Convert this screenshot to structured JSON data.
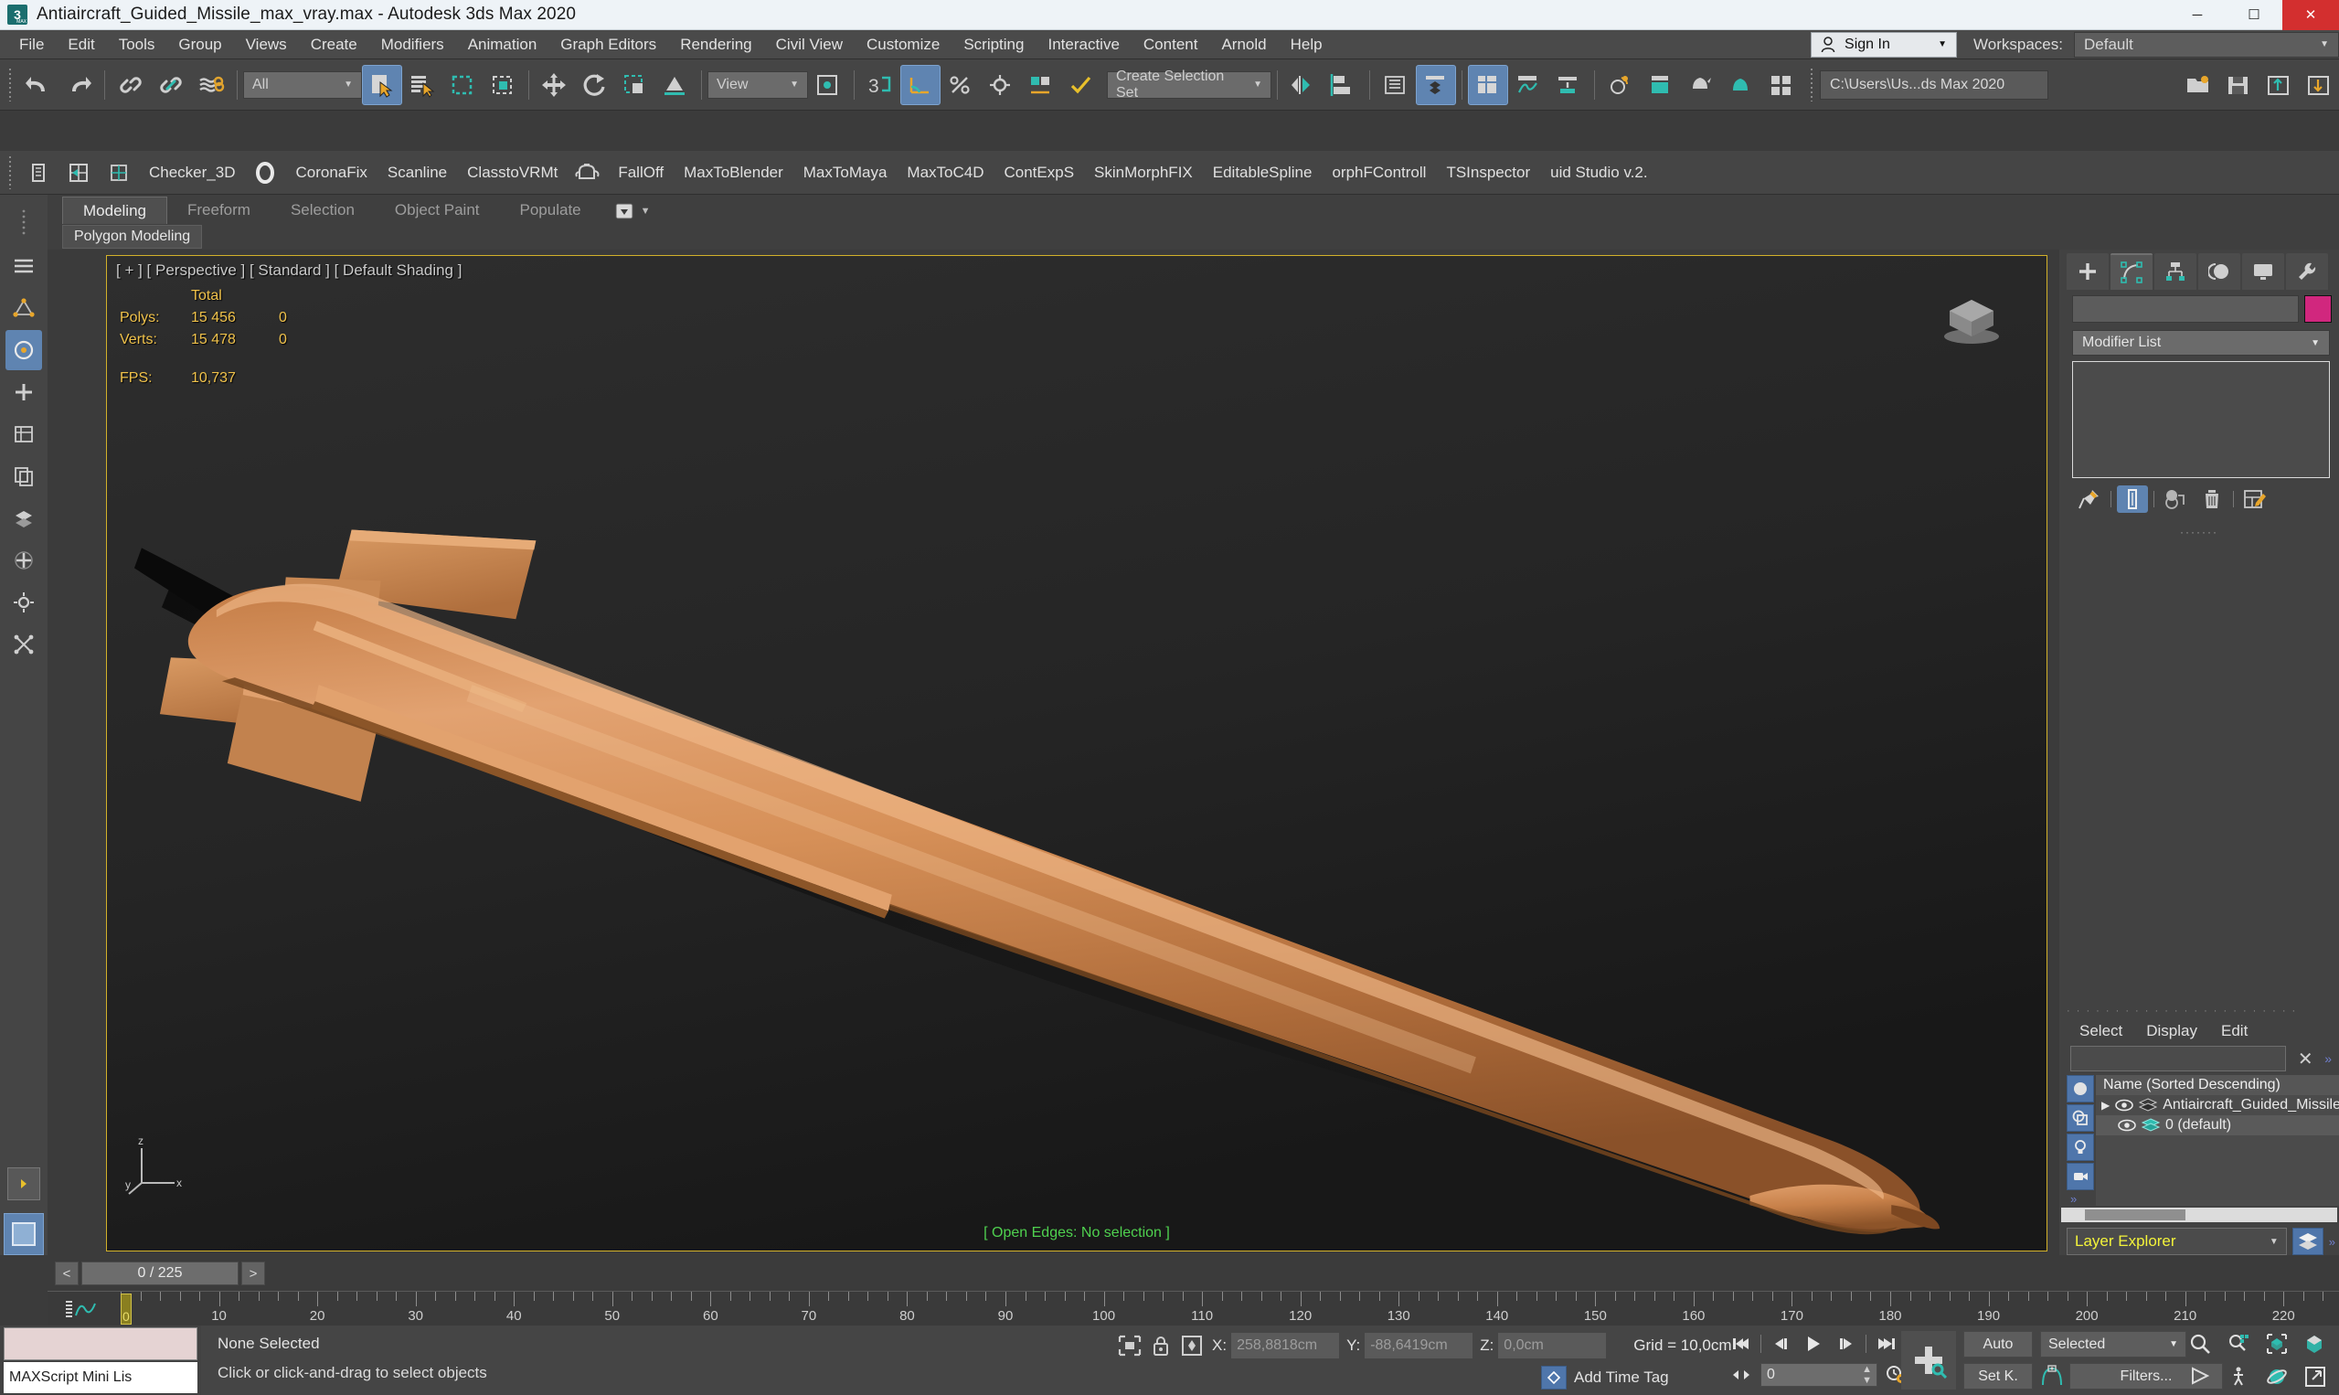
{
  "window": {
    "title": "Antiaircraft_Guided_Missile_max_vray.max - Autodesk 3ds Max 2020",
    "logo_text": "3",
    "logo_sub": "MAX",
    "minimize": "─",
    "maximize": "☐",
    "close": "✕"
  },
  "menu": {
    "items": [
      "File",
      "Edit",
      "Tools",
      "Group",
      "Views",
      "Create",
      "Modifiers",
      "Animation",
      "Graph Editors",
      "Rendering",
      "Civil View",
      "Customize",
      "Scripting",
      "Interactive",
      "Content",
      "Arnold",
      "Help"
    ],
    "sign_in": "Sign In",
    "workspaces_label": "Workspaces:",
    "workspace_value": "Default",
    "caret": "▼"
  },
  "toolbar": {
    "selection_filter": "All",
    "selection_set": "Create Selection Set",
    "project_path": "C:\\Users\\Us...ds Max 2020",
    "caret": "▼",
    "icons": [
      "undo-icon",
      "redo-icon",
      "select-link-icon",
      "unlink-icon",
      "bind-space-warp-icon",
      "select-object-icon",
      "select-by-name-icon",
      "rectangular-region-icon",
      "window-crossing-icon",
      "select-move-icon",
      "select-rotate-icon",
      "select-scale-icon",
      "placement-icon",
      "reference-coord-icon",
      "pivot-icon",
      "snaps-toggle-icon",
      "angle-snap-icon",
      "percent-snap-icon",
      "spinner-snap-icon",
      "named-sel-sets-icon",
      "mirror-icon",
      "align-icon",
      "layer-explorer-icon",
      "scene-explorer-icon",
      "ribbon-icon",
      "curve-editor-icon",
      "schematic-view-icon",
      "material-editor-icon",
      "render-setup-icon",
      "render-frame-window-icon",
      "render-production-icon",
      "render-iterative-icon",
      "open-ase-icon"
    ]
  },
  "plugin_bar": {
    "items": [
      "Checker_3D",
      "CoronaFix",
      "Scanline",
      "ClasstoVRMt",
      "FallOff",
      "MaxToBlender",
      "MaxToMaya",
      "MaxToC4D",
      "ContExpS",
      "SkinMorphFIX",
      "EditableSpline",
      "orphFControll",
      "TSInspector",
      "uid Studio v.2."
    ]
  },
  "ribbon": {
    "tabs": [
      "Modeling",
      "Freeform",
      "Selection",
      "Object Paint",
      "Populate"
    ],
    "active_tab": "Modeling",
    "sub_label": "Polygon Modeling",
    "overflow_caret": "▼"
  },
  "viewport": {
    "label": "[ + ] [ Perspective ] [ Standard ] [ Default Shading ]",
    "stats": {
      "total_header": "Total",
      "rows": [
        {
          "name": "Polys:",
          "total": "15 456",
          "selected": "0"
        },
        {
          "name": "Verts:",
          "total": "15 478",
          "selected": "0"
        }
      ],
      "fps_label": "FPS:",
      "fps_value": "10,737"
    },
    "open_edges": "[ Open Edges: No selection ]",
    "axis": {
      "x": "x",
      "y": "y",
      "z": "z"
    },
    "model_color": "#d08b50",
    "background_color": "#262626"
  },
  "command_panel": {
    "tabs": [
      "create-tab",
      "modify-tab",
      "hierarchy-tab",
      "motion-tab",
      "display-tab",
      "utilities-tab"
    ],
    "active_tab": "modify-tab",
    "object_name": "",
    "object_color": "#d1277e",
    "modifier_list": "Modifier List",
    "caret": "▼",
    "stack_tools": [
      "pin-stack-icon",
      "show-end-result-icon",
      "make-unique-icon",
      "remove-modifier-icon",
      "configure-sets-icon"
    ],
    "dots": "·······"
  },
  "explorer": {
    "menu": [
      "Select",
      "Display",
      "Edit"
    ],
    "search_value": "",
    "clear_icon": "✕",
    "chevrons": "»",
    "column_header": "Name (Sorted Descending)",
    "rows": [
      {
        "label": "Antiaircraft_Guided_Missile",
        "expander": "▶",
        "eye": "eye-icon",
        "layer": "layer-icon",
        "selected": false
      },
      {
        "label": "0 (default)",
        "expander": "",
        "eye": "eye-icon",
        "layer": "layer-icon",
        "selected": true
      }
    ],
    "footer_combo": "Layer Explorer",
    "footer_caret": "▼"
  },
  "timeline": {
    "prev_label": "<",
    "next_label": ">",
    "frame_display": "0 / 225",
    "current_frame": 0,
    "max_frame": 225,
    "tick_labels": [
      10,
      20,
      30,
      40,
      50,
      60,
      70,
      80,
      90,
      100,
      110,
      120,
      130,
      140,
      150,
      160,
      170,
      180,
      190,
      200,
      210,
      220
    ],
    "playhead_label": "0"
  },
  "status_bar": {
    "maxscript_label": "MAXScript Mini Lis",
    "selection_status": "None Selected",
    "prompt": "Click or click-and-drag to select objects",
    "coords": [
      {
        "axis": "X:",
        "value": "258,8818cm"
      },
      {
        "axis": "Y:",
        "value": "-88,6419cm"
      },
      {
        "axis": "Z:",
        "value": "0,0cm"
      }
    ],
    "grid": "Grid = 10,0cm",
    "add_time_tag": "Add Time Tag",
    "frame_value": "0",
    "auto_key": "Auto",
    "set_key": "Set K.",
    "key_filter_mode": "Selected",
    "filters": "Filters...",
    "caret": "▼",
    "nav_icons": [
      "zoom-icon",
      "zoom-all-icon",
      "zoom-extents-icon",
      "zoom-region-icon",
      "pan-icon",
      "walkthrough-icon",
      "orbit-icon",
      "maximize-viewport-icon"
    ]
  }
}
